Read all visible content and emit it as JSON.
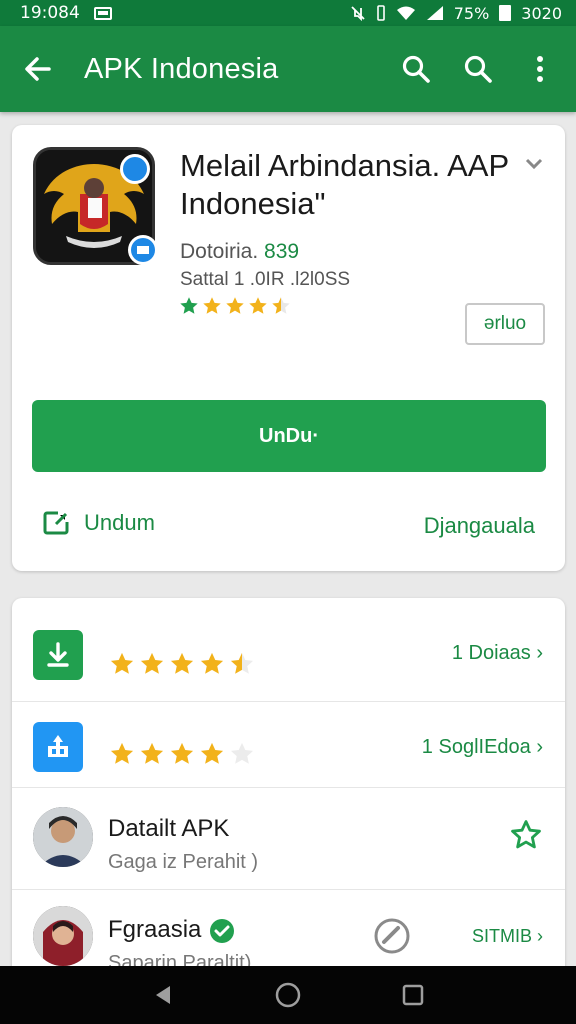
{
  "status_bar": {
    "time": "19:084",
    "battery": "75%",
    "right_time": "3020"
  },
  "app_bar": {
    "title": "APK Indonesia"
  },
  "app": {
    "title": "Melail Arbindansia. AAP Indonesia\"",
    "developer_label": "Dotoiria.",
    "developer_number": "839",
    "meta": "Sattal 1 .0IR .l2l0SS",
    "rating_stars": 4.5,
    "outline_button": "ərluo",
    "install_button": "UnDu·",
    "link_left": "Undum",
    "link_right": "Djangauala"
  },
  "list": [
    {
      "type": "stat",
      "icon": "download-icon",
      "stars": 4.5,
      "right": "1  Doiaas ›"
    },
    {
      "type": "stat",
      "icon": "share-icon",
      "stars": 4,
      "right": "1  SoglIEdoa ›"
    },
    {
      "type": "person",
      "name": "Datailt APK",
      "subtitle": "Gaga iz Perahit )",
      "action_icon": "star-outline-icon"
    },
    {
      "type": "person",
      "name": "Fgraasia",
      "subtitle": "Saparin Paraltit)",
      "right": "SITMIB ›",
      "badge": "verified-icon"
    }
  ],
  "colors": {
    "status_bar": "#0f7a3a",
    "app_bar": "#1b8a44",
    "accent": "#21a04f",
    "star": "#f2b21b",
    "blue": "#2196f3"
  }
}
